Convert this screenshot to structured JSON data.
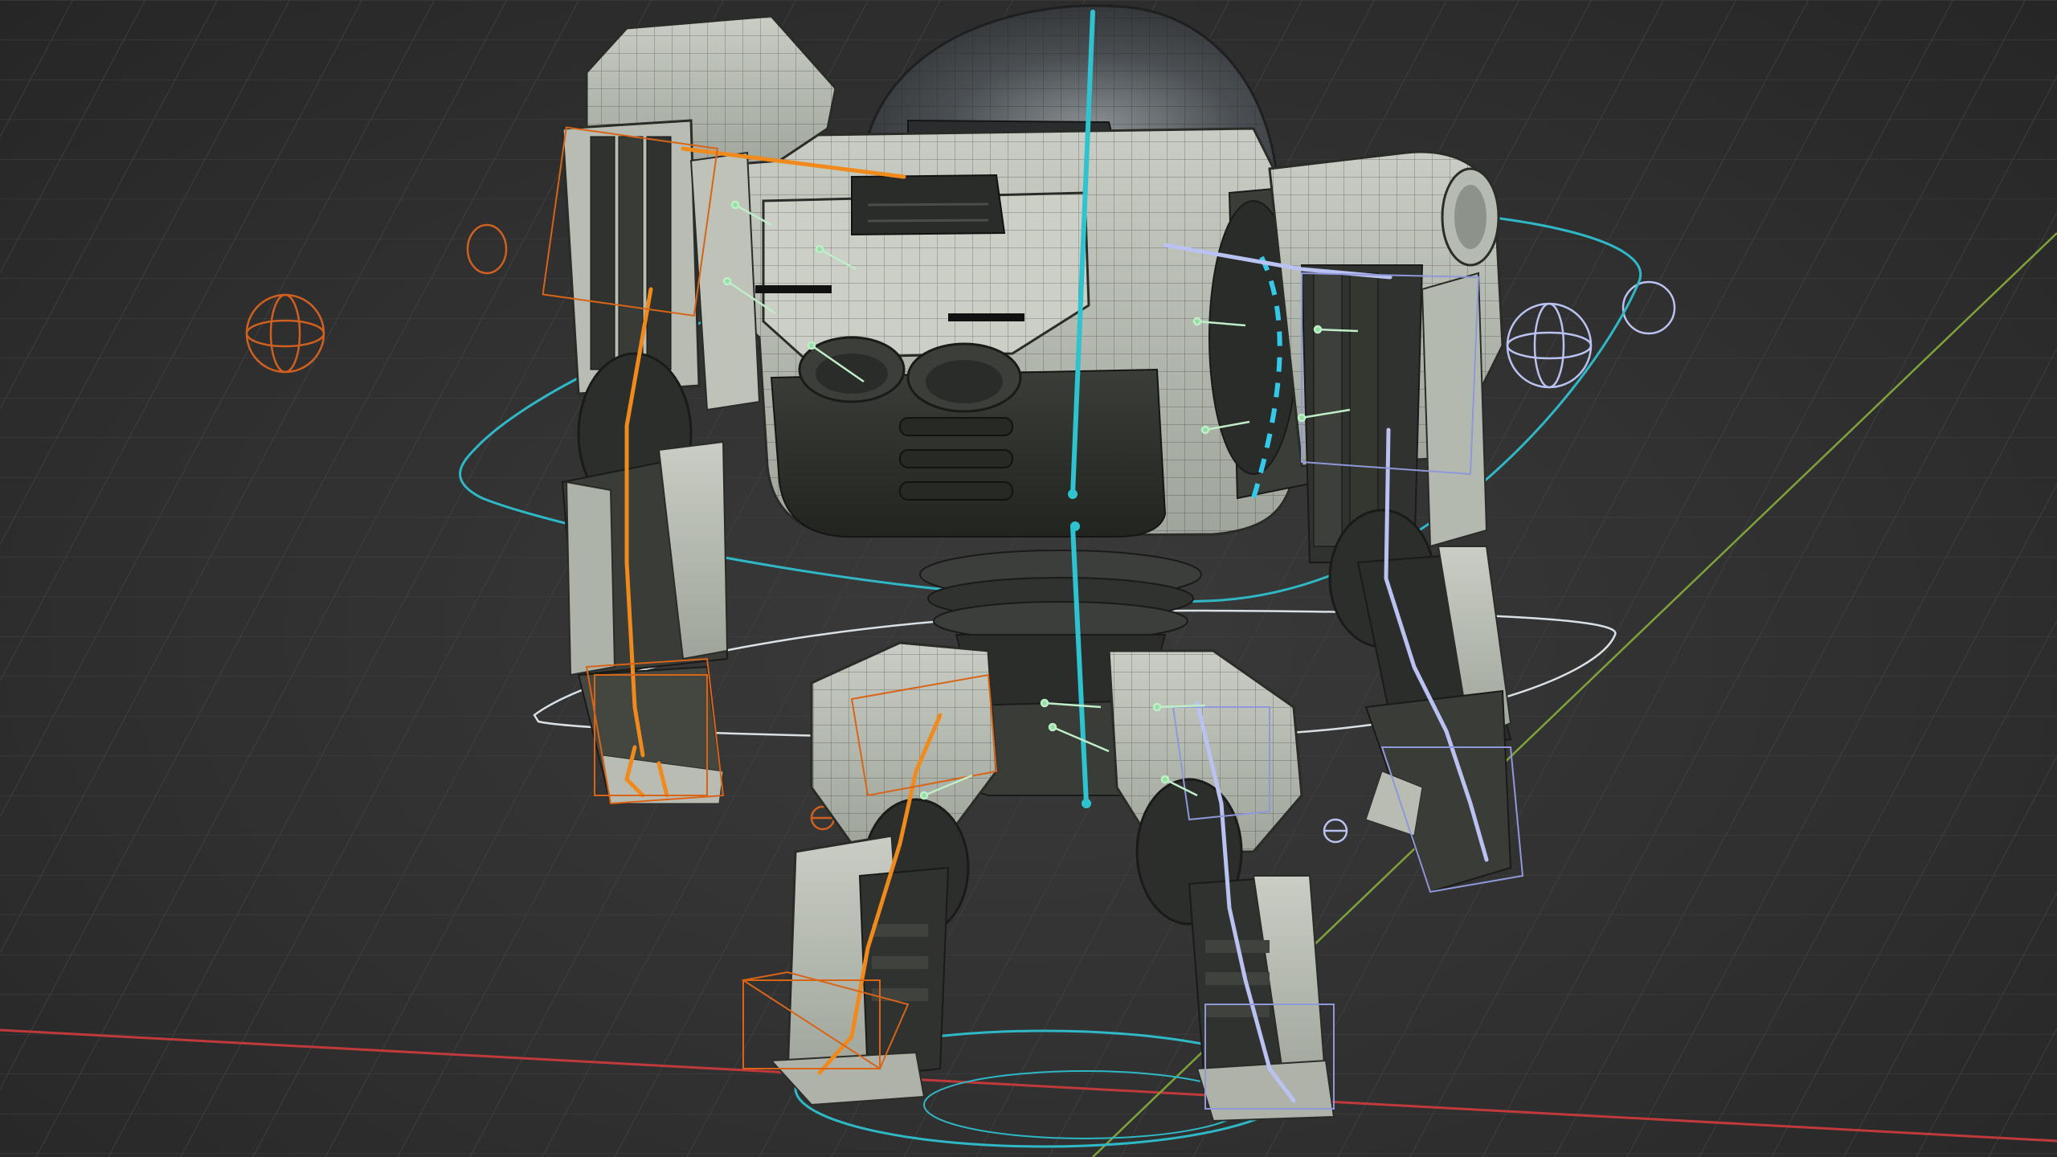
{
  "viewport": {
    "mode": "3d-viewport",
    "shading": "wireframe-overlay-on-solid",
    "overlays": {
      "grid_floor": true,
      "x_axis_color": "#c0393b",
      "y_axis_color": "#7fa33a",
      "show_armature": true,
      "show_wireframe": true
    }
  },
  "scene": {
    "object": "robot-mech",
    "armature_colors": {
      "left_side": "#f08a1c",
      "center": "#2fc3d0",
      "right_side": "#b9c2f0",
      "control_widgets": "#d06020"
    },
    "body_color": "#b9beb4",
    "dark_panel_color": "#2d302c",
    "dome_color": "#3a3d40",
    "accent_light_color": "#35c8e8"
  }
}
